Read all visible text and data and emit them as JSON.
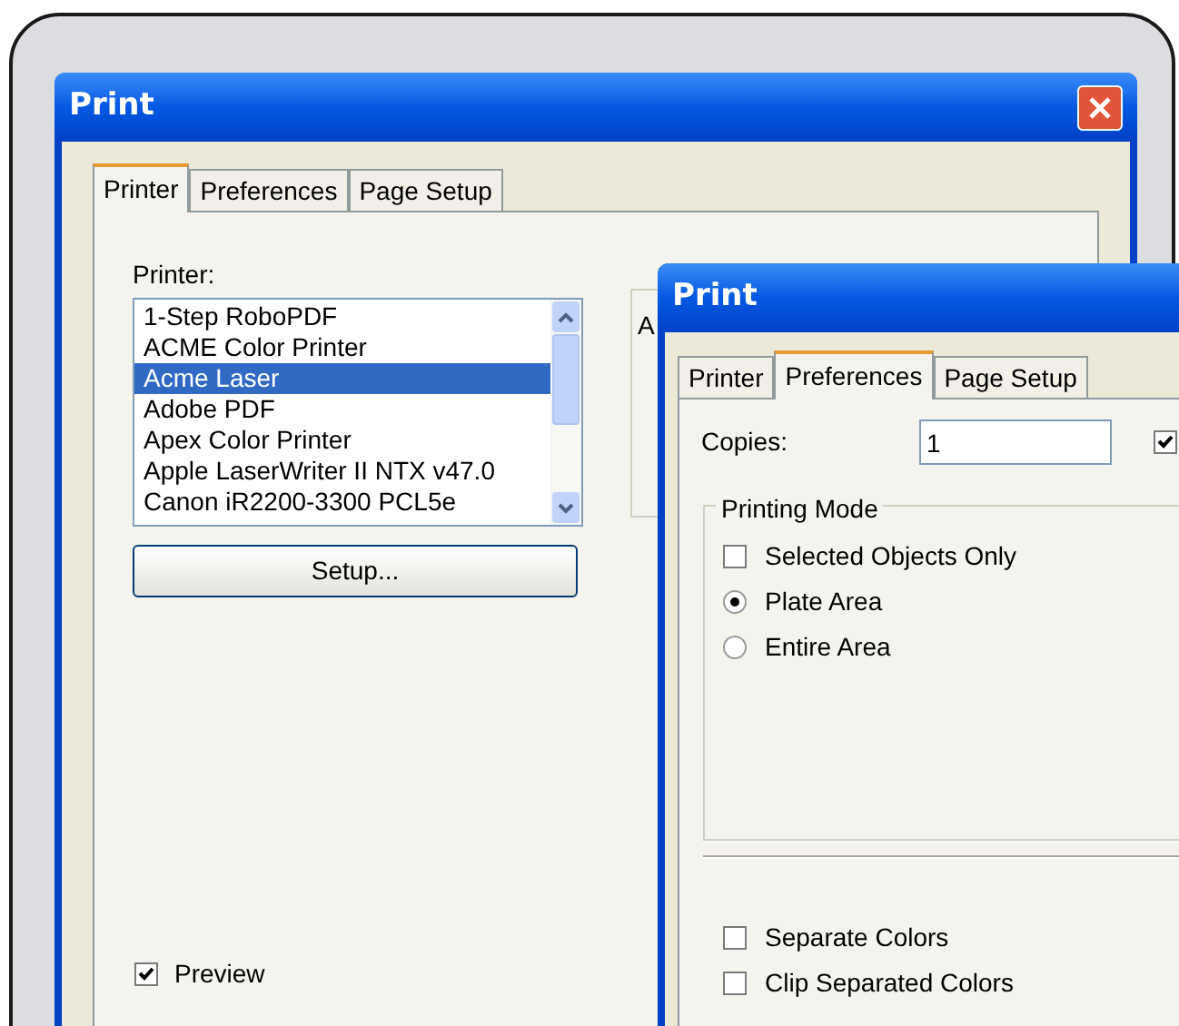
{
  "back_dialog": {
    "title": "Print",
    "tabs": [
      {
        "label": "Printer",
        "selected": true
      },
      {
        "label": "Preferences",
        "selected": false
      },
      {
        "label": "Page Setup",
        "selected": false
      }
    ],
    "printer_label": "Printer:",
    "printers": [
      {
        "name": "1-Step RoboPDF",
        "selected": false
      },
      {
        "name": "ACME Color Printer",
        "selected": false
      },
      {
        "name": "Acme Laser",
        "selected": true
      },
      {
        "name": "Adobe PDF",
        "selected": false
      },
      {
        "name": "Apex Color Printer",
        "selected": false
      },
      {
        "name": "Apple LaserWriter II NTX v47.0",
        "selected": false
      },
      {
        "name": "Canon iR2200-3300 PCL5e",
        "selected": false
      }
    ],
    "setup_button": "Setup...",
    "group_text": "A",
    "preview": {
      "label": "Preview",
      "checked": true
    }
  },
  "front_dialog": {
    "title": "Print",
    "tabs": [
      {
        "label": "Printer",
        "selected": false
      },
      {
        "label": "Preferences",
        "selected": true
      },
      {
        "label": "Page Setup",
        "selected": false
      }
    ],
    "copies_label": "Copies:",
    "copies_value": "1",
    "side_checkbox": {
      "checked": true
    },
    "printing_mode": {
      "title": "Printing Mode",
      "options": [
        {
          "kind": "checkbox",
          "label": "Selected Objects Only",
          "checked": false
        },
        {
          "kind": "radio",
          "label": "Plate Area",
          "selected": true
        },
        {
          "kind": "radio",
          "label": "Entire Area",
          "selected": false
        }
      ]
    },
    "options": [
      {
        "label": "Separate Colors",
        "checked": false
      },
      {
        "label": "Clip Separated Colors",
        "checked": false
      }
    ]
  }
}
